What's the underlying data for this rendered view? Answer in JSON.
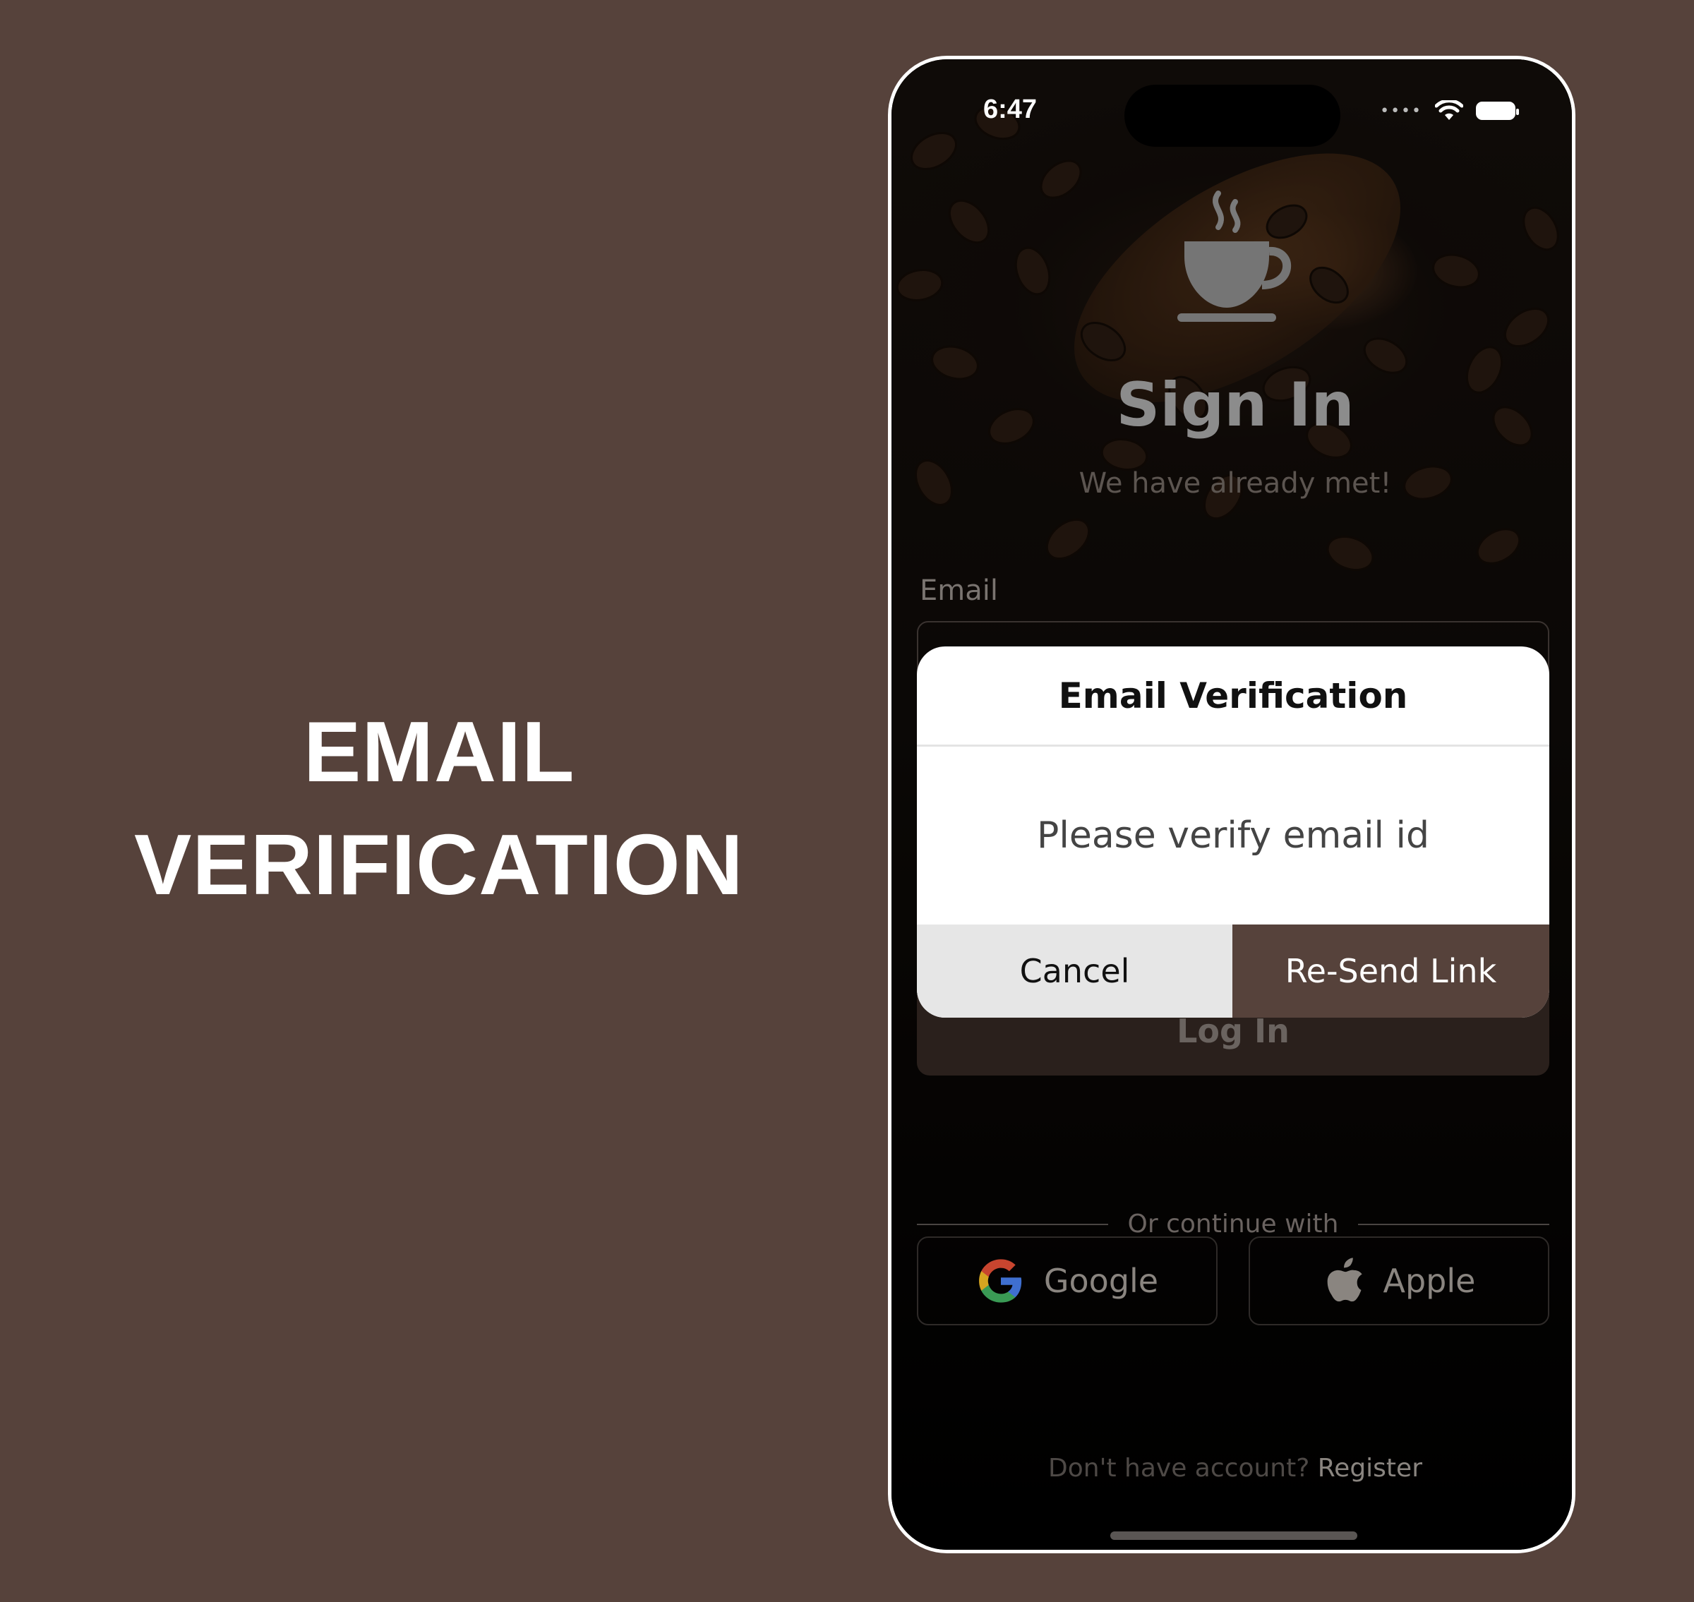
{
  "headline": {
    "line1": "EMAIL",
    "line2": "VERIFICATION"
  },
  "status_bar": {
    "time": "6:47"
  },
  "signin": {
    "title": "Sign In",
    "subtitle": "We have already met!",
    "email_label": "Email",
    "login_button": "Log In",
    "divider_text": "Or continue with",
    "google_label": "Google",
    "apple_label": "Apple",
    "register_question": "Don't have account?",
    "register_link": "Register"
  },
  "dialog": {
    "title": "Email Verification",
    "message": "Please verify email id",
    "cancel_label": "Cancel",
    "resend_label": "Re-Send Link"
  },
  "colors": {
    "page_background": "#56423b",
    "accent": "#56423b",
    "dialog_background": "#ffffff",
    "cancel_background": "#e6e6e6"
  },
  "icons": [
    "coffee-cup-icon",
    "wifi-icon",
    "battery-icon",
    "google-icon",
    "apple-icon"
  ]
}
